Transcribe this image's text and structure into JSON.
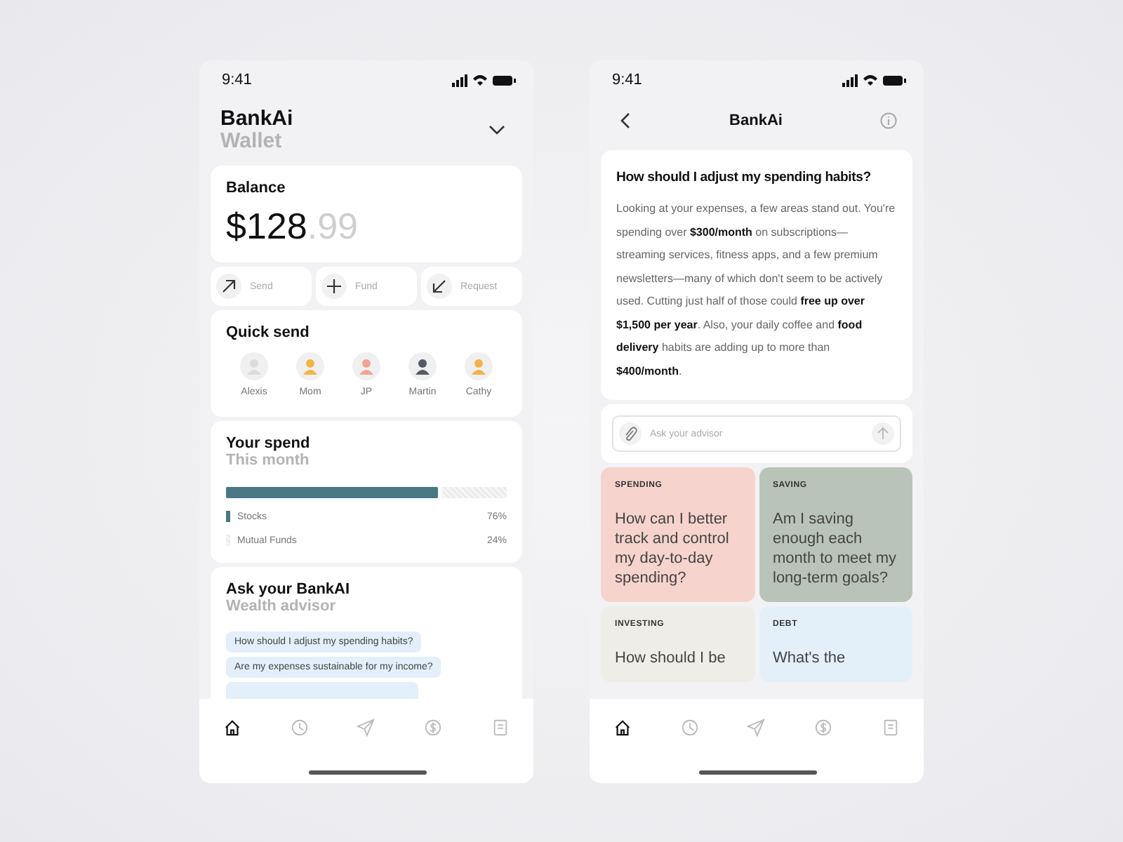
{
  "screens": [
    {
      "kind": "wallet",
      "time": "9:41",
      "app": "BankAi",
      "subtitle": "Wallet",
      "balance": {
        "label": "Balance",
        "whole": "$128",
        "cents": ".99"
      },
      "actions": [
        {
          "kind": "send",
          "label": "Send"
        },
        {
          "kind": "fund",
          "label": "Fund"
        },
        {
          "kind": "request",
          "label": "Request"
        }
      ],
      "quick_send": {
        "title": "Quick send",
        "contacts": [
          {
            "name": "Alexis",
            "color": "#dcdcdc"
          },
          {
            "name": "Mom",
            "color": "#f2b544"
          },
          {
            "name": "JP",
            "color": "#f0a594"
          },
          {
            "name": "Martin",
            "color": "#555a66"
          },
          {
            "name": "Cathy",
            "color": "#f3b24a"
          }
        ]
      },
      "spend": {
        "title": "Your spend",
        "subtitle": "This month",
        "items": [
          {
            "kind": "solid",
            "label": "Stocks",
            "value": "76%",
            "level": 0.76
          },
          {
            "kind": "hatched",
            "label": "Mutual Funds",
            "value": "24%",
            "level": 0.24
          }
        ]
      },
      "advisor": {
        "title": "Ask your BankAI",
        "subtitle": "Wealth advisor",
        "suggestions": [
          "How should I adjust my spending habits?",
          "Are my expenses sustainable for my income?"
        ]
      },
      "nav": [
        {
          "kind": "home",
          "selected": true
        },
        {
          "kind": "history",
          "selected": false
        },
        {
          "kind": "send",
          "selected": false
        },
        {
          "kind": "money",
          "selected": false
        },
        {
          "kind": "document",
          "selected": false
        }
      ]
    },
    {
      "kind": "chat",
      "time": "9:41",
      "app": "BankAi",
      "answer": {
        "question": "How should I adjust my spending habits?",
        "text": "Looking at your expenses, a few areas stand out. You're spending over **$300/month** on subscriptions—streaming services, fitness apps, and a few premium newsletters—many of which don't seem to be actively used. Cutting just half of those could **free up over $1,500 per year**. Also, your daily coffee and **food delivery** habits are adding up to more than **$400/month**."
      },
      "input": {
        "placeholder": "Ask your advisor"
      },
      "topics": [
        {
          "label": "SPENDING",
          "question": "How can I better track and control my day-to-day spending?",
          "color": "#f6d3cc"
        },
        {
          "label": "SAVING",
          "question": "Am I saving enough each month to meet my long-term goals?",
          "color": "#bac3b9"
        },
        {
          "label": "INVESTING",
          "question": "How should I be",
          "color": "#efede8"
        },
        {
          "label": "DEBT",
          "question": "What's the",
          "color": "#e3f0fa"
        }
      ],
      "nav": [
        {
          "kind": "home",
          "selected": true
        },
        {
          "kind": "history",
          "selected": false
        },
        {
          "kind": "send",
          "selected": false
        },
        {
          "kind": "money",
          "selected": false
        },
        {
          "kind": "document",
          "selected": false
        }
      ]
    }
  ]
}
